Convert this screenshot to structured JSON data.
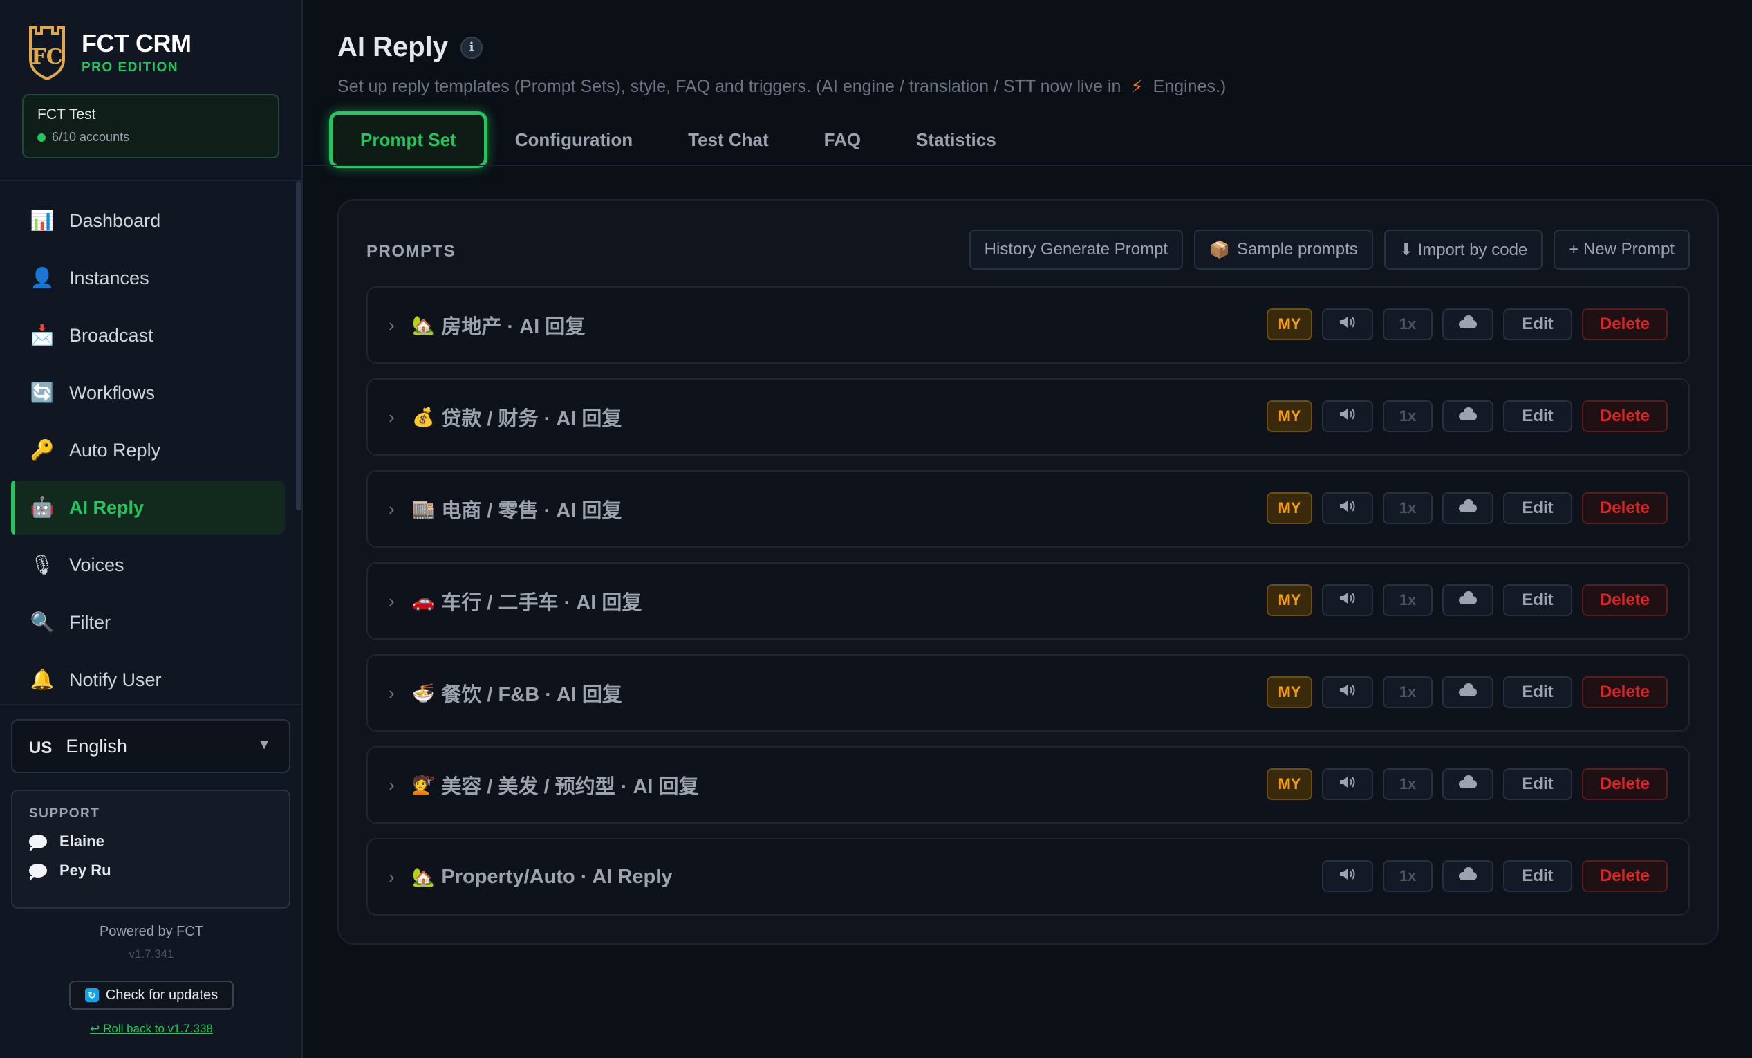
{
  "sidebar": {
    "brand_title": "FCT CRM",
    "brand_subtitle": "PRO EDITION",
    "logo_text": "FC",
    "account_name": "FCT Test",
    "account_count": "6/10 accounts",
    "nav": [
      {
        "label": "Dashboard",
        "icon": "📊",
        "icon_name": "bar-chart-icon"
      },
      {
        "label": "Instances",
        "icon": "👤",
        "icon_name": "person-icon"
      },
      {
        "label": "Broadcast",
        "icon": "📩",
        "icon_name": "envelope-icon"
      },
      {
        "label": "Workflows",
        "icon": "🔄",
        "icon_name": "refresh-icon"
      },
      {
        "label": "Auto Reply",
        "icon": "🔑",
        "icon_name": "key-icon"
      },
      {
        "label": "AI Reply",
        "icon": "🤖",
        "icon_name": "robot-icon",
        "active": true
      },
      {
        "label": "Voices",
        "icon": "🎙",
        "icon_name": "microphone-icon"
      },
      {
        "label": "Filter",
        "icon": "🔍",
        "icon_name": "magnifier-icon"
      },
      {
        "label": "Notify User",
        "icon": "🔔",
        "icon_name": "bell-icon"
      }
    ],
    "language_flag": "US",
    "language": "English",
    "support_title": "SUPPORT",
    "support": [
      "Elaine",
      "Pey Ru"
    ],
    "powered_by": "Powered by FCT",
    "version": "v1.7.341",
    "check_updates": "Check for updates",
    "rollback": "↩ Roll back to v1.7.338"
  },
  "header": {
    "title": "AI Reply",
    "subtitle_pre": "Set up reply templates (Prompt Sets), style, FAQ and triggers. (AI engine / translation / STT now live in",
    "subtitle_post": "Engines.)"
  },
  "tabs": [
    "Prompt Set",
    "Configuration",
    "Test Chat",
    "FAQ",
    "Statistics"
  ],
  "panel": {
    "title": "PROMPTS",
    "actions": {
      "history": "History Generate Prompt",
      "sample": "Sample prompts",
      "import": "⬇ Import by code",
      "new": "+ New Prompt"
    },
    "badge_my": "MY",
    "speed": "1x",
    "edit": "Edit",
    "delete": "Delete",
    "prompts": [
      {
        "emoji": "🏡",
        "name": "房地产 · AI 回复",
        "my": true
      },
      {
        "emoji": "💰",
        "name": "贷款 / 财务 · AI 回复",
        "my": true
      },
      {
        "emoji": "🏬",
        "name": "电商 / 零售 · AI 回复",
        "my": true
      },
      {
        "emoji": "🚗",
        "name": "车行 / 二手车 · AI 回复",
        "my": true
      },
      {
        "emoji": "🍜",
        "name": "餐饮 / F&B · AI 回复",
        "my": true
      },
      {
        "emoji": "💇",
        "name": "美容 / 美发 / 预约型 · AI 回复",
        "my": true
      },
      {
        "emoji": "🏡",
        "name": "Property/Auto · AI Reply",
        "my": false
      }
    ]
  },
  "colors": {
    "accent": "#22c55e",
    "danger": "#dc2626",
    "warning": "#f59e0b",
    "background": "#0b0f16"
  }
}
